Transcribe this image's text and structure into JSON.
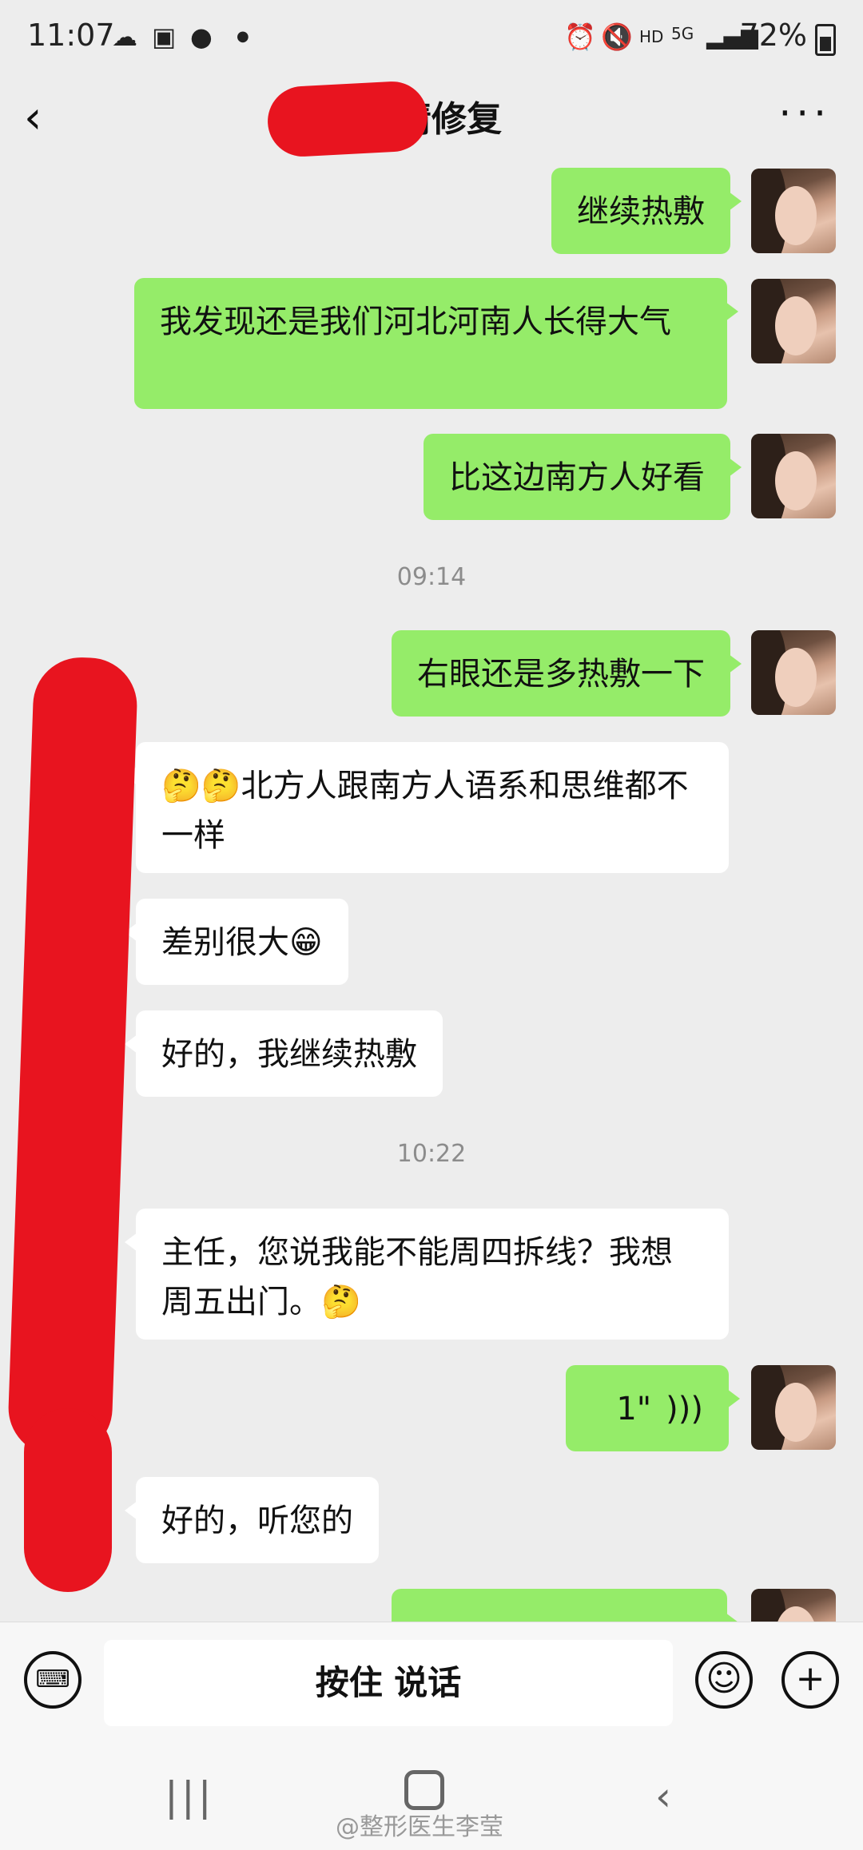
{
  "status_bar": {
    "time": "11:07",
    "network": "5G",
    "hd": "HD",
    "battery": "72%"
  },
  "header": {
    "title": "眼睛修复",
    "back_icon": "chevron-left-icon",
    "more_icon": "more-dots-icon"
  },
  "messages": [
    {
      "side": "me",
      "text": "继续热敷"
    },
    {
      "side": "me",
      "text": "我发现还是我们河北河南人长得大气"
    },
    {
      "side": "me",
      "text": "比这边南方人好看"
    },
    {
      "type": "time",
      "text": "09:14"
    },
    {
      "side": "me",
      "text": "右眼还是多热敷一下"
    },
    {
      "side": "other",
      "text": "🤔🤔北方人跟南方人语系和思维都不一样"
    },
    {
      "side": "other",
      "text": "差别很大😁"
    },
    {
      "side": "other",
      "text": "好的，我继续热敷"
    },
    {
      "type": "time",
      "text": "10:22"
    },
    {
      "side": "other",
      "text": "主任，您说我能不能周四拆线？我想周五出门。🤔"
    },
    {
      "side": "me",
      "type": "voice",
      "text": "1\""
    },
    {
      "side": "other",
      "text": "好的，听您的"
    }
  ],
  "input_bar": {
    "talk_label": "按住 说话",
    "keyboard_icon": "keyboard-icon",
    "emoji_icon": "emoji-icon",
    "plus_icon": "plus-icon"
  },
  "nav_bar": {
    "recent_icon": "recent-apps-icon",
    "home_icon": "home-icon",
    "back_icon": "back-icon"
  },
  "watermark": "@整形医生李莹",
  "colors": {
    "my_bubble": "#95ec69",
    "other_bubble": "#ffffff",
    "background": "#ededed",
    "redaction": "#e8141f"
  }
}
